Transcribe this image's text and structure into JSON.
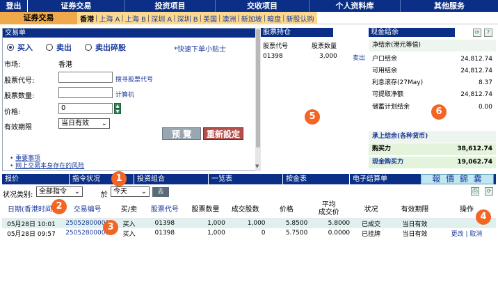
{
  "topbar": {
    "logout": "登出",
    "items": [
      "证券交易",
      "投资项目",
      "交收项目",
      "个人资料库",
      "其他服务"
    ]
  },
  "subbar": {
    "active": "证券交易",
    "markets": [
      "香港",
      "上海 A",
      "上海 B",
      "深圳 A",
      "深圳 B",
      "美国",
      "澳洲",
      "新加坡",
      "暗盘",
      "新股认购"
    ]
  },
  "order": {
    "title": "交易单",
    "buy": "买入",
    "sell": "卖出",
    "sell_odd": "卖出碎股",
    "quick_tip": "*快速下单小贴士",
    "market_label": "市场:",
    "market_value": "香港",
    "code_label": "股票代号:",
    "code_link": "搜寻股票代号",
    "qty_label": "股票数量:",
    "calc_link": "计算机",
    "price_label": "价格:",
    "price_value": "0",
    "validity_label": "有效期限",
    "validity_value": "当日有效",
    "notice1": "重要事项",
    "notice2": "网上交易本身存在的风险",
    "preview_btn": "预 覽",
    "reset_btn": "重新設定"
  },
  "holdings": {
    "title": "股票持仓",
    "col_code": "股票代号",
    "col_qty": "股票数量",
    "rows": [
      {
        "code": "01398",
        "qty": "3,000",
        "action": "卖出"
      }
    ]
  },
  "cash": {
    "title": "现金结余",
    "subtitle": "净结余(港元等值)",
    "rows": [
      {
        "k": "户口结余",
        "v": "24,812.74"
      },
      {
        "k": "可用结余",
        "v": "24,812.74"
      },
      {
        "k": "利息滚存(27May)",
        "v": "8.37"
      },
      {
        "k": "可提取净额",
        "v": "24,812.74"
      },
      {
        "k": "储蓄计划结余",
        "v": "0.00"
      }
    ],
    "link": "承上结余(各种货币)",
    "buying_power_label": "购买力",
    "buying_power_value": "38,612.74",
    "cash_bp_label": "现金购买力",
    "cash_bp_value": "19,062.74"
  },
  "tabs": [
    "报价",
    "指令状况",
    "投资组合",
    "一览表",
    "按金表",
    "电子结算单"
  ],
  "summary_btn": "報 價 錦 囊",
  "filter": {
    "status_label": "状况类别:",
    "status_value": "全部指令",
    "on_label": "於",
    "day_value": "今天",
    "go_btn": "去"
  },
  "orders_table": {
    "headers": [
      "日期(香港时间)",
      "交易编号",
      "买/卖",
      "股票代号",
      "股票数量",
      "成交股数",
      "价格",
      "平均\n成交价",
      "状况",
      "有效期限",
      "操作"
    ],
    "rows": [
      [
        "05月28日 10:01",
        "25052800003",
        "买入",
        "01398",
        "1,000",
        "1,000",
        "5.8500",
        "5.8000",
        "已成交",
        "当日有效",
        ""
      ],
      [
        "05月28日 09:57",
        "25052800003",
        "买入",
        "01398",
        "1,000",
        "0",
        "5.7500",
        "0.0000",
        "已挂牌",
        "当日有效",
        "更改 | 取消"
      ]
    ]
  },
  "badges": [
    "1",
    "2",
    "3",
    "4",
    "5",
    "6"
  ]
}
